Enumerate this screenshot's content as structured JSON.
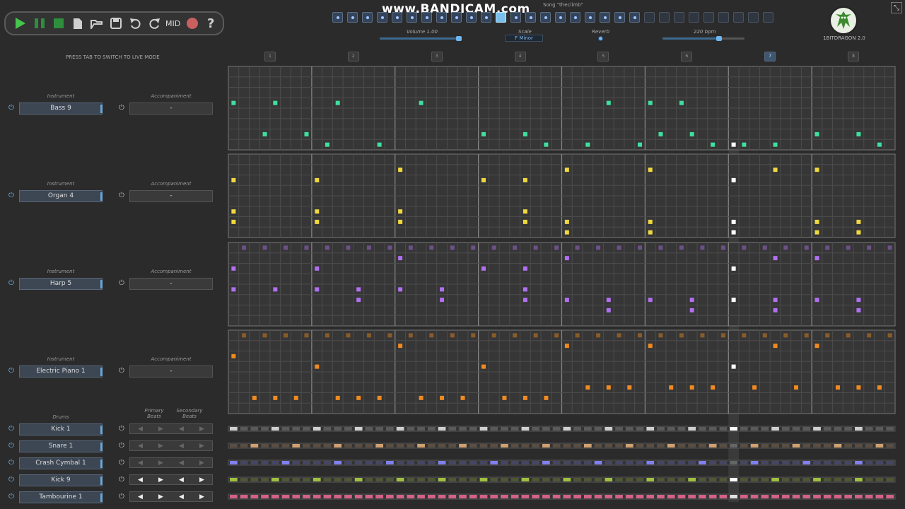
{
  "watermark": "www.BANDICAM.com",
  "song_title": "Song \"theclimb\"",
  "song_slots": {
    "filled": 21,
    "empty": 9,
    "active_index": 11
  },
  "params": {
    "volume_label": "Volume 1.00",
    "volume_value": 1.0,
    "scale_label": "Scale",
    "scale_value": "F Minor",
    "reverb_label": "Reverb",
    "tempo_label": "220 bpm",
    "tempo_value": 220
  },
  "toolbar": {
    "mid_label": "MID"
  },
  "logo_text": "1BITDRAGON 2.0",
  "live_hint": "PRESS TAB TO SWITCH TO LIVE MODE",
  "bars": [
    "1",
    "2",
    "3",
    "4",
    "5",
    "6",
    "7",
    "8"
  ],
  "current_bar": 7,
  "colors": {
    "bass": "#3ee0a0",
    "organ": "#f0d840",
    "harp": "#b070f0",
    "epiano": "#f08a20",
    "kick1": "#d0d0d0",
    "snare": "#d0a070",
    "crash": "#8080f0",
    "kick9": "#a0c040",
    "tamb": "#f06a9a",
    "playhead": "#ffffff",
    "accent": "#6eb6f0"
  },
  "labels": {
    "instrument": "Instrument",
    "accompaniment": "Accompaniment",
    "drums": "Drums",
    "primary": "Primary Beats",
    "secondary": "Secondary Beats"
  },
  "tracks": [
    {
      "instrument": "Bass 9",
      "accompaniment": "-"
    },
    {
      "instrument": "Organ 4",
      "accompaniment": "-"
    },
    {
      "instrument": "Harp 5",
      "accompaniment": "-"
    },
    {
      "instrument": "Electric Piano 1",
      "accompaniment": "-"
    }
  ],
  "drums": [
    "Kick 1",
    "Snare 1",
    "Crash Cymbal 1",
    "Kick 9",
    "Tambourine 1"
  ]
}
